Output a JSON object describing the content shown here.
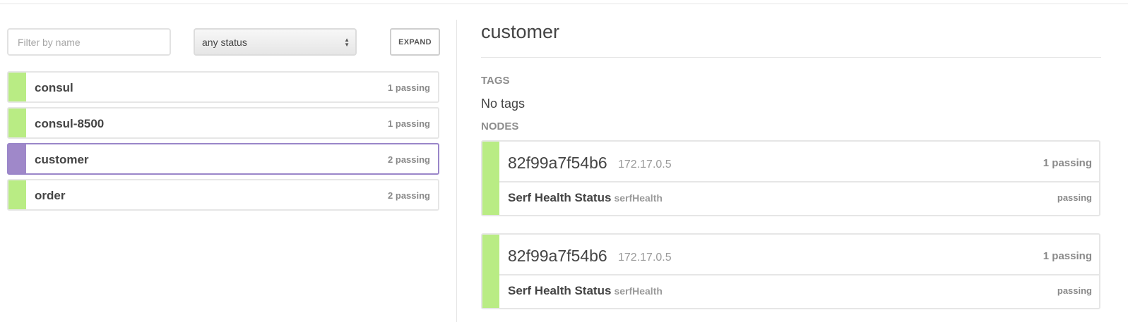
{
  "filter": {
    "placeholder": "Filter by name",
    "value": ""
  },
  "status_filter": {
    "selected": "any status"
  },
  "expand_label": "EXPAND",
  "services": [
    {
      "name": "consul",
      "count": "1 passing",
      "selected": false
    },
    {
      "name": "consul-8500",
      "count": "1 passing",
      "selected": false
    },
    {
      "name": "customer",
      "count": "2 passing",
      "selected": true
    },
    {
      "name": "order",
      "count": "2 passing",
      "selected": false
    }
  ],
  "detail": {
    "title": "customer",
    "tags_label": "TAGS",
    "tags_value": "No tags",
    "nodes_label": "NODES",
    "nodes": [
      {
        "name": "82f99a7f54b6",
        "address": "172.17.0.5",
        "count": "1 passing",
        "check": {
          "name": "Serf Health Status",
          "id": "serfHealth",
          "status": "passing"
        }
      },
      {
        "name": "82f99a7f54b6",
        "address": "172.17.0.5",
        "count": "1 passing",
        "check": {
          "name": "Serf Health Status",
          "id": "serfHealth",
          "status": "passing"
        }
      }
    ]
  },
  "colors": {
    "passing": "#b9ec84",
    "selected": "#9f88c9",
    "selected_border": "#9a86c9"
  }
}
